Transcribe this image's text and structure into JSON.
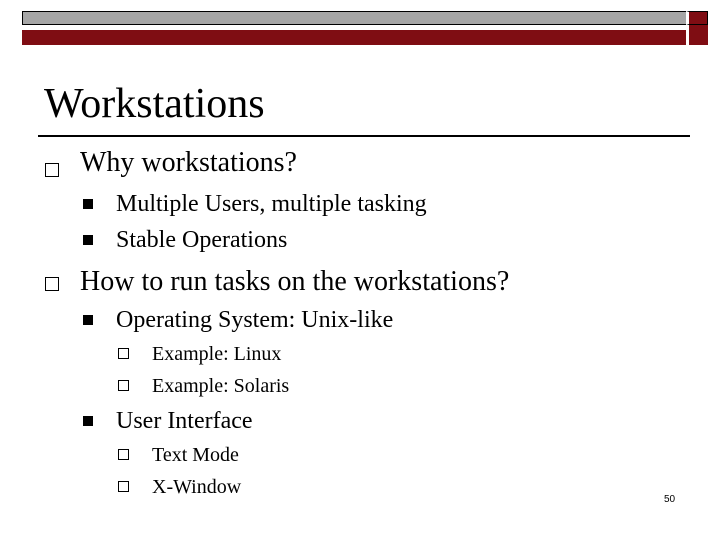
{
  "slide": {
    "title": "Workstations",
    "page_number": "50",
    "colors": {
      "header_grey": "#a6a6a6",
      "header_red": "#7f0d13",
      "text": "#000000"
    },
    "bullets": [
      {
        "text": "Why workstations?",
        "bullet_icon": "hollow-square",
        "children": [
          {
            "text": "Multiple Users, multiple tasking",
            "bullet_icon": "filled-square"
          },
          {
            "text": "Stable Operations",
            "bullet_icon": "filled-square"
          }
        ]
      },
      {
        "text": "How to run tasks on the workstations?",
        "bullet_icon": "hollow-square",
        "children": [
          {
            "text": "Operating System: Unix-like",
            "bullet_icon": "filled-square",
            "children": [
              {
                "text": "Example: Linux",
                "bullet_icon": "hollow-square"
              },
              {
                "text": "Example: Solaris",
                "bullet_icon": "hollow-square"
              }
            ]
          },
          {
            "text": "User Interface",
            "bullet_icon": "filled-square",
            "children": [
              {
                "text": "Text Mode",
                "bullet_icon": "hollow-square"
              },
              {
                "text": "X-Window",
                "bullet_icon": "hollow-square"
              }
            ]
          }
        ]
      }
    ]
  }
}
